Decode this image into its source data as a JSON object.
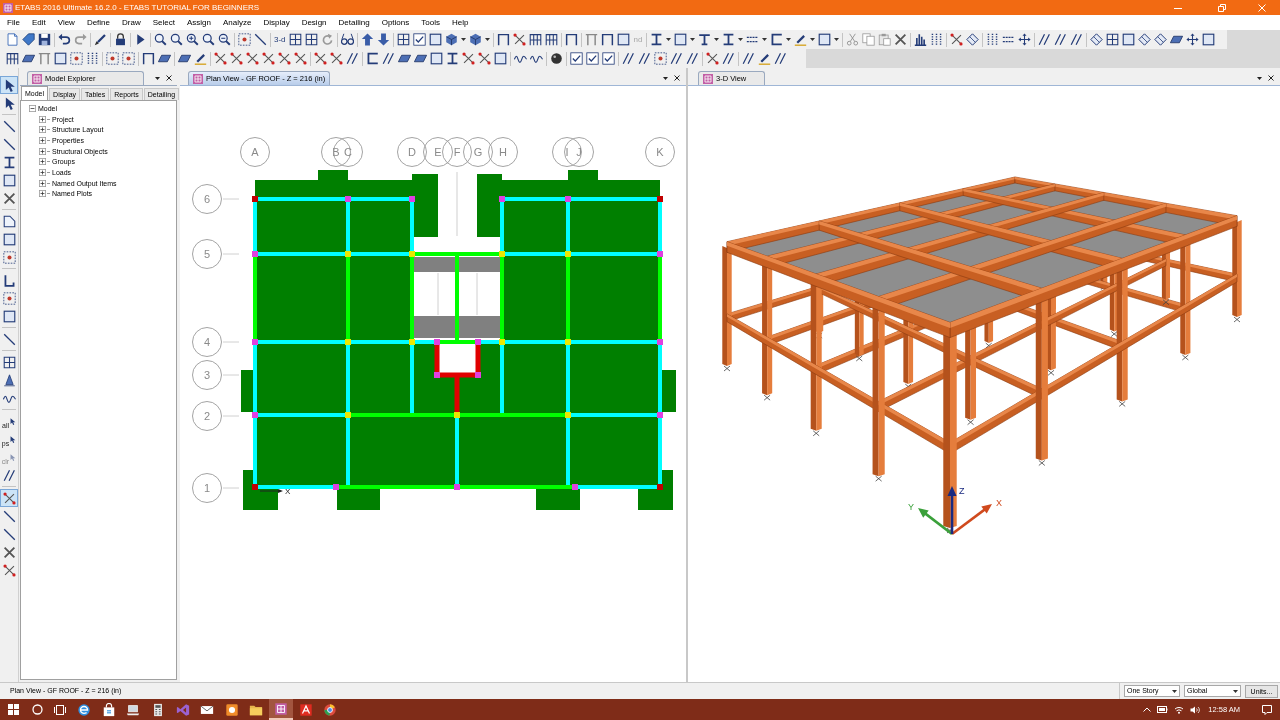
{
  "window": {
    "title": "ETABS 2016 Ultimate 16.2.0 - ETABS TUTORIAL FOR BEGINNERS"
  },
  "menu": [
    "File",
    "Edit",
    "View",
    "Define",
    "Draw",
    "Select",
    "Assign",
    "Analyze",
    "Display",
    "Design",
    "Detailing",
    "Options",
    "Tools",
    "Help"
  ],
  "toolbar": {
    "text_buttons": [
      {
        "label": "3-d",
        "disabled": false
      },
      {
        "label": "nd",
        "disabled": true
      }
    ]
  },
  "left_toolbar": [
    {
      "selected": true,
      "disabled": false
    },
    {
      "selected": false,
      "disabled": false
    },
    {
      "selected": false,
      "disabled": false
    },
    {
      "selected": false,
      "disabled": false
    },
    {
      "selected": false,
      "disabled": false
    },
    {
      "selected": false,
      "disabled": false
    },
    {
      "selected": false,
      "disabled": false
    },
    {
      "selected": false,
      "disabled": false
    },
    {
      "selected": false,
      "disabled": false
    },
    {
      "selected": false,
      "disabled": false
    },
    {
      "selected": false,
      "disabled": false
    },
    {
      "selected": false,
      "disabled": false
    },
    {
      "selected": false,
      "disabled": false
    },
    {
      "selected": false,
      "disabled": false
    },
    {
      "selected": false,
      "disabled": false
    },
    {
      "selected": false,
      "disabled": false
    },
    {
      "selected": false,
      "disabled": false
    },
    {
      "label": "all",
      "selected": false,
      "disabled": false
    },
    {
      "label": "ps",
      "selected": false,
      "disabled": false
    },
    {
      "label": "clr",
      "selected": false,
      "disabled": true
    },
    {
      "selected": false,
      "disabled": false
    },
    {
      "selected": true,
      "disabled": false
    },
    {
      "selected": false,
      "disabled": false
    },
    {
      "selected": false,
      "disabled": false
    },
    {
      "selected": false,
      "disabled": false
    },
    {
      "selected": false,
      "disabled": false
    }
  ],
  "model_explorer": {
    "title": "Model Explorer",
    "tabs": [
      {
        "label": "Model",
        "selected": true
      },
      {
        "label": "Display",
        "selected": false
      },
      {
        "label": "Tables",
        "selected": false
      },
      {
        "label": "Reports",
        "selected": false
      },
      {
        "label": "Detailing",
        "selected": false
      }
    ],
    "tree": [
      {
        "label": "Model",
        "expanded": true,
        "children": [
          {
            "label": "Project",
            "expanded": false
          },
          {
            "label": "Structure Layout",
            "expanded": false
          },
          {
            "label": "Properties",
            "expanded": false
          },
          {
            "label": "Structural Objects",
            "expanded": false
          },
          {
            "label": "Groups",
            "expanded": false
          },
          {
            "label": "Loads",
            "expanded": false
          },
          {
            "label": "Named Output Items",
            "expanded": false
          },
          {
            "label": "Named Plots",
            "expanded": false
          }
        ]
      }
    ]
  },
  "plan_view": {
    "tab": {
      "title": "Plan View - GF ROOF - Z = 216 (in)",
      "selected": true
    },
    "grid_columns": [
      "A",
      "B",
      "C",
      "D",
      "E",
      "F",
      "G",
      "H",
      "I",
      "J",
      "K"
    ],
    "grid_rows": [
      "6",
      "5",
      "4",
      "3",
      "2",
      "1"
    ],
    "axis_label": "X"
  },
  "view_3d": {
    "tab": {
      "title": "3-D View",
      "selected": false
    },
    "axes": [
      {
        "label": "X",
        "color": "#d04a1e"
      },
      {
        "label": "Y",
        "color": "#3aa03a"
      },
      {
        "label": "Z",
        "color": "#1a2a80"
      }
    ]
  },
  "status_bar": {
    "text": "Plan View - GF ROOF - Z = 216 (in)",
    "story": "One Story",
    "coordinates": "Global",
    "units_button": "Units..."
  },
  "taskbar": {
    "apps": [
      {
        "selected": false
      },
      {
        "selected": false
      },
      {
        "selected": false
      },
      {
        "selected": false
      },
      {
        "selected": false
      },
      {
        "selected": false
      },
      {
        "selected": false
      },
      {
        "selected": false
      },
      {
        "selected": true
      },
      {
        "selected": false
      },
      {
        "selected": false
      }
    ],
    "time": "12:58 AM"
  }
}
